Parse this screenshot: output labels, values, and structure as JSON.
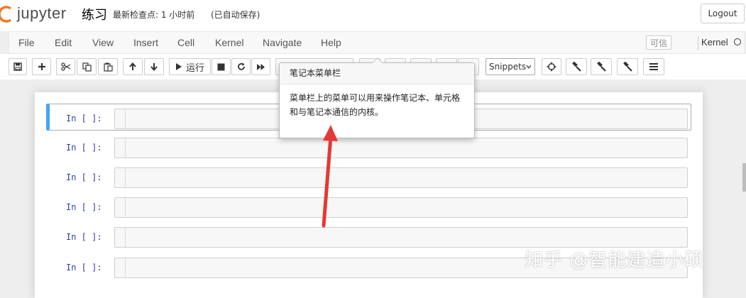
{
  "header": {
    "logo_text": "jupyter",
    "notebook_title": "练习",
    "checkpoint": "最新检查点: 1 小时前",
    "autosave": "(已自动保存)",
    "logout_label": "Logout"
  },
  "menubar": {
    "items": [
      "File",
      "Edit",
      "View",
      "Insert",
      "Cell",
      "Kernel",
      "Navigate",
      "Help"
    ],
    "trusted_label": "可信",
    "kernel_label": "Kernel"
  },
  "toolbar": {
    "run_label": "运行",
    "cell_type": "Snippets"
  },
  "cells": [
    {
      "prompt": "In  [ ]:"
    },
    {
      "prompt": "In  [ ]:"
    },
    {
      "prompt": "In  [ ]:"
    },
    {
      "prompt": "In  [ ]:"
    },
    {
      "prompt": "In  [ ]:"
    },
    {
      "prompt": "In  [ ]:"
    }
  ],
  "tooltip": {
    "title": "笔记本菜单栏",
    "body": "菜单栏上的菜单可以用来操作笔记本、单元格和与笔记本通信的内核。"
  },
  "watermark": "知乎 @智能建造小硕",
  "colors": {
    "selected_cell_border": "#42A5F5",
    "logo_orange": "#F37726",
    "annotation_arrow": "#E53935",
    "prompt_blue": "#303F9F"
  },
  "icons": [
    "save-icon",
    "plus-icon",
    "cut-icon",
    "copy-icon",
    "paste-icon",
    "arrow-up-icon",
    "arrow-down-icon",
    "play-icon",
    "stop-icon",
    "restart-icon",
    "fast-forward-icon",
    "crosshairs-icon",
    "gavel-icon",
    "gavel-icon",
    "gavel-icon",
    "list-icon"
  ]
}
